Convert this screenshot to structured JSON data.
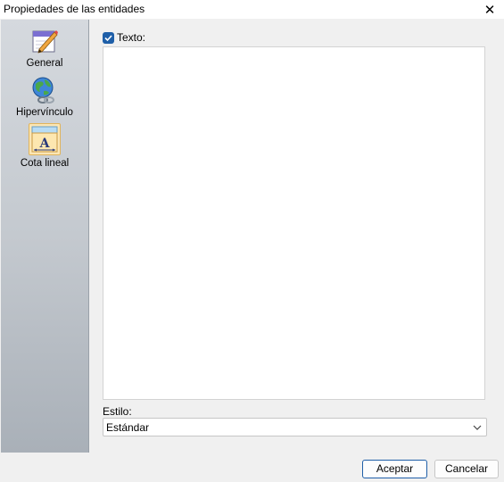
{
  "window": {
    "title": "Propiedades de las entidades",
    "close_glyph": "✕"
  },
  "sidebar": {
    "items": [
      {
        "label": "General",
        "icon": "pencil-notepad-icon",
        "selected": false
      },
      {
        "label": "Hipervínculo",
        "icon": "globe-link-icon",
        "selected": false
      },
      {
        "label": "Cota lineal",
        "icon": "linear-dimension-icon",
        "selected": true
      }
    ]
  },
  "main": {
    "text_checkbox": {
      "label": "Texto:",
      "checked": true
    },
    "text_value": "",
    "style": {
      "label": "Estilo:",
      "selected": "Estándar"
    }
  },
  "footer": {
    "ok_label": "Aceptar",
    "cancel_label": "Cancelar"
  },
  "colors": {
    "accent": "#1f5fa8",
    "selected_item_bg": "#fbe6b5"
  }
}
